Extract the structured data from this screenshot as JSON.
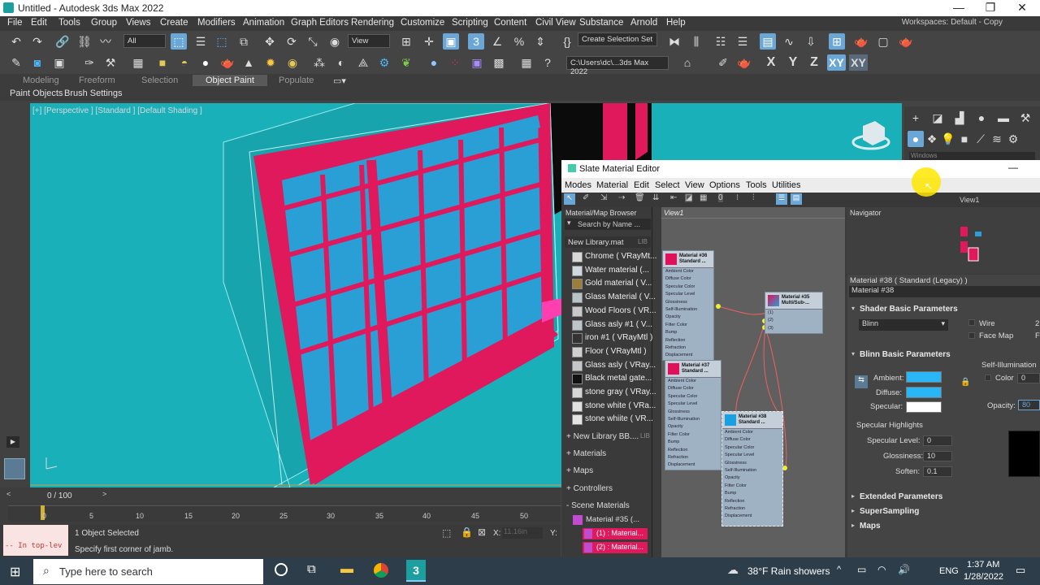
{
  "window": {
    "title": "Untitled - Autodesk 3ds Max 2022",
    "minimize": "—",
    "maximize": "❐",
    "close": "✕"
  },
  "menu": [
    "File",
    "Edit",
    "Tools",
    "Group",
    "Views",
    "Create",
    "Modifiers",
    "Animation",
    "Graph Editors",
    "Rendering",
    "Customize",
    "Scripting",
    "Content",
    "Civil View",
    "Substance",
    "Arnold",
    "Help"
  ],
  "workspaces": "Workspaces:  Default - Copy",
  "toolbar": {
    "filter_value": "All",
    "refcoord_value": "View",
    "selection_set_value": "Create Selection Set",
    "project_path": "C:\\Users\\dc\\...3ds Max 2022",
    "axis_buttons": [
      "X",
      "Y",
      "Z",
      "XY",
      "XY"
    ]
  },
  "ribbon": {
    "tabs": [
      "Modeling",
      "Freeform",
      "Selection",
      "Object Paint",
      "Populate"
    ],
    "selected": "Object Paint",
    "subtabs": [
      "Paint Objects",
      "Brush Settings"
    ]
  },
  "viewport": {
    "label": "[+] [Perspective ] [Standard ] [Default Shading ]"
  },
  "command_panel": {
    "dropdown": "Windows"
  },
  "timeline": {
    "frame_display": "0 / 100",
    "ticks": [
      "0",
      "5",
      "10",
      "15",
      "20",
      "25",
      "30",
      "35",
      "40",
      "45",
      "50"
    ]
  },
  "status": {
    "maxscript": "-- In top-lev",
    "selected": "1 Object Selected",
    "prompt": "Specify first corner of jamb.",
    "x_label": "X:",
    "x_value": "11.16in",
    "y_label": "Y:"
  },
  "slate": {
    "title": "Slate Material Editor",
    "menu": [
      "Modes",
      "Material",
      "Edit",
      "Select",
      "View",
      "Options",
      "Tools",
      "Utilities"
    ],
    "view_tab": "View1",
    "view_tab_right": "View1",
    "browser_title": "Material/Map Browser",
    "search_placeholder": "Search by Name ...",
    "library_name": "New Library.mat",
    "library_tag": "LIB",
    "library_items": [
      {
        "label": "Chrome  ( VRayMt...",
        "color": "#d9d9d9"
      },
      {
        "label": "Water material  (...",
        "color": "#cfd8dc"
      },
      {
        "label": "Gold material  ( V...",
        "color": "#9c7d3a"
      },
      {
        "label": "Glass Material  ( V...",
        "color": "#b8c4c8"
      },
      {
        "label": "Wood Floors  ( VR...",
        "color": "#c9c9c9"
      },
      {
        "label": "Glass asly #1  ( V...",
        "color": "#bfc6c8"
      },
      {
        "label": "iron #1  ( VRayMtl )",
        "color": "#333333"
      },
      {
        "label": "Floor  ( VRayMtl )",
        "color": "#d0d0d0"
      },
      {
        "label": "Glass asly  ( VRay...",
        "color": "#c4c8ca"
      },
      {
        "label": "Black metal gate...",
        "color": "#111111"
      },
      {
        "label": "stone gray  ( VRay...",
        "color": "#d6d6d6"
      },
      {
        "label": "stone white  ( VRa...",
        "color": "#e0e0e0"
      },
      {
        "label": "stone whiite  ( VR...",
        "color": "#e4e4e4"
      }
    ],
    "sections": [
      "+ New Library BB....",
      "+ Materials",
      "+ Maps",
      "+ Controllers",
      "- Scene Materials"
    ],
    "section_tag": "LIB",
    "scene_items": [
      "Material #35  (...",
      "(1) : Material...",
      "(2) : Material..."
    ],
    "navigator": "Navigator",
    "nodes": [
      {
        "title": "Material #36 Standard ...",
        "swatch": "#e0105a"
      },
      {
        "title": "Material #35 Multi/Sub-...",
        "swatch": "#e0105a"
      },
      {
        "title": "Material #37 Standard ...",
        "swatch": "#e0105a"
      },
      {
        "title": "Material #38 Standard ...",
        "swatch": "#1aa0e0"
      }
    ],
    "node_slots": [
      "Ambient Color",
      "Diffuse Color",
      "Specular Color",
      "Specular Level",
      "Glossiness",
      "Self-Illumination",
      "Opacity",
      "Filter Color",
      "Bump",
      "Reflection",
      "Refraction",
      "Displacement"
    ],
    "multisub_slots": [
      "(1)",
      "(2)",
      "(3)"
    ],
    "params": {
      "header": "Material #38  ( Standard (Legacy) )",
      "name": "Material #38",
      "shader_rollout": "Shader Basic Parameters",
      "shader_type": "Blinn",
      "wire": "Wire",
      "facemap": "Face Map",
      "two": "2",
      "f": "F",
      "blinn_rollout": "Blinn Basic Parameters",
      "self_illum": "Self-Illumination",
      "color_label": "Color",
      "color_value": "0",
      "ambient": "Ambient:",
      "diffuse": "Diffuse:",
      "specular": "Specular:",
      "opacity": "Opacity:",
      "opacity_value": "80",
      "spec_highlights": "Specular Highlights",
      "spec_level": "Specular Level:",
      "spec_level_value": "0",
      "glossiness": "Glossiness:",
      "glossiness_value": "10",
      "soften": "Soften:",
      "soften_value": "0.1",
      "extended": "Extended Parameters",
      "supersampling": "SuperSampling",
      "maps": "Maps",
      "ambient_color": "#29b6f6",
      "diffuse_color": "#29b6f6",
      "specular_color": "#ffffff"
    }
  },
  "taskbar": {
    "search_placeholder": "Type here to search",
    "weather": "38°F  Rain showers",
    "language": "ENG",
    "time": "1:37 AM",
    "date": "1/28/2022"
  },
  "colors": {
    "viewport_bg": "#19b0ba",
    "frame": "#e0185c",
    "glass": "#2a9fd6"
  }
}
